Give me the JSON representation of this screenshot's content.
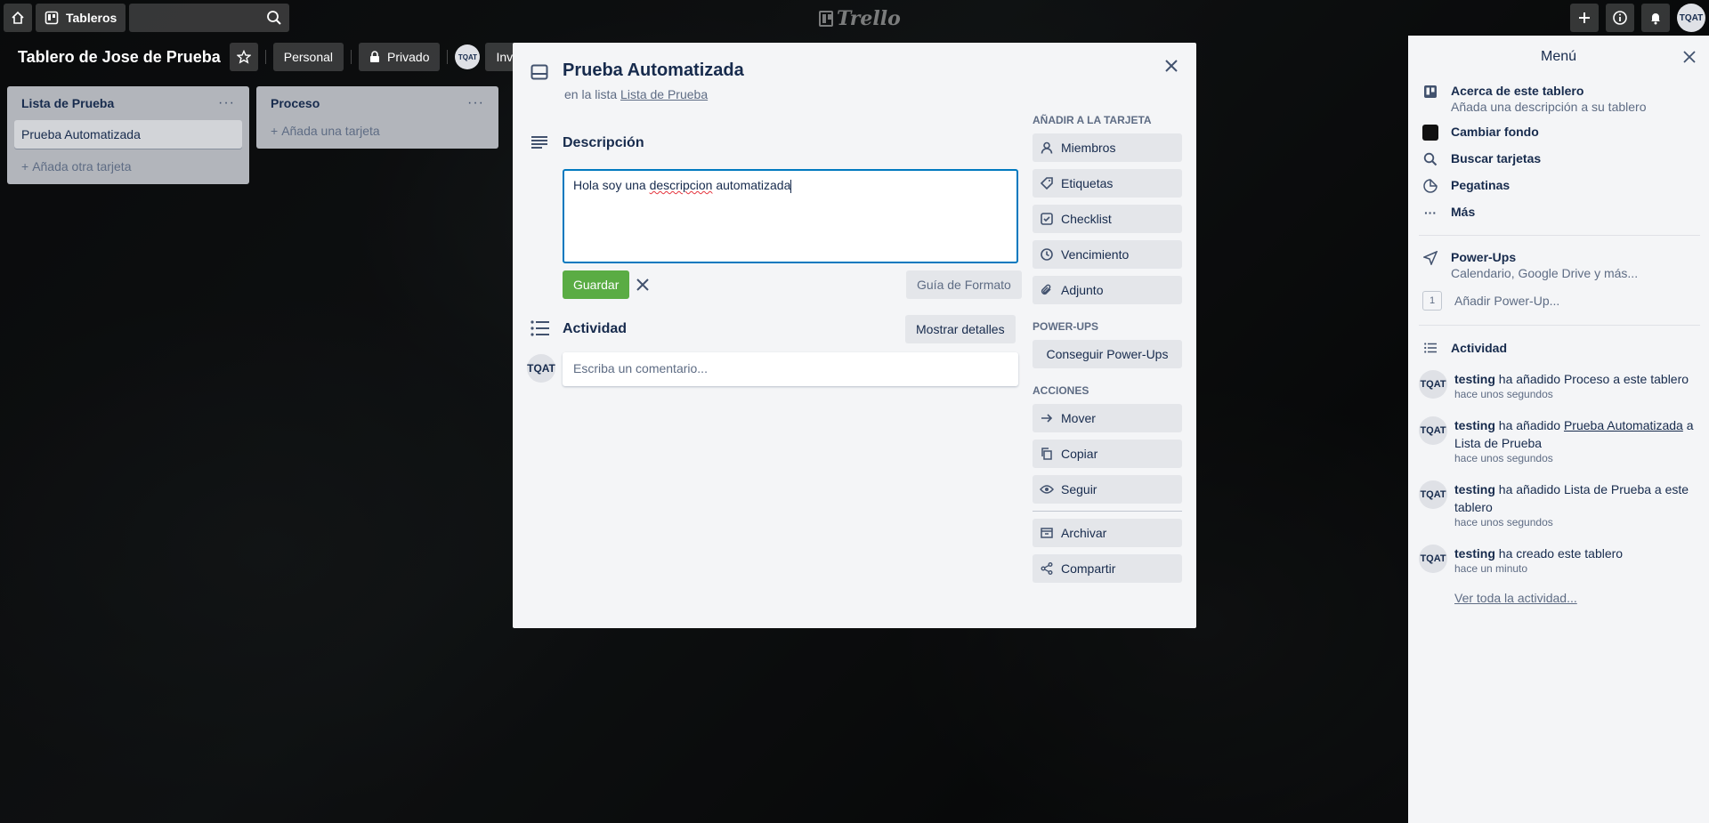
{
  "header": {
    "boards_label": "Tableros",
    "logo_text": "Trello",
    "avatar_initials": "TQAT"
  },
  "board": {
    "title": "Tablero de Jose de Prueba",
    "personal_label": "Personal",
    "privado_label": "Privado",
    "member_initials": "TQAT",
    "invite_label": "Inv"
  },
  "lists": [
    {
      "title": "Lista de Prueba",
      "cards": [
        "Prueba Automatizada"
      ],
      "add_label": "Añada otra tarjeta"
    },
    {
      "title": "Proceso",
      "cards": [],
      "add_label": "Añada una tarjeta"
    }
  ],
  "modal": {
    "title": "Prueba Automatizada",
    "in_list_prefix": "en la lista",
    "in_list_link": "Lista de Prueba",
    "description_heading": "Descripción",
    "description_value": {
      "before": "Hola soy una ",
      "misspelled": "descripcion",
      "after": " automatizada"
    },
    "save_label": "Guardar",
    "format_guide_label": "Guía de Formato",
    "activity_heading": "Actividad",
    "show_details_label": "Mostrar detalles",
    "comment_avatar": "TQAT",
    "comment_placeholder": "Escriba un comentario..."
  },
  "card_sidebar": {
    "add_heading": "Añadir a la tarjeta",
    "add_buttons": [
      "Miembros",
      "Etiquetas",
      "Checklist",
      "Vencimiento",
      "Adjunto"
    ],
    "powerups_heading": "Power-Ups",
    "powerups_button": "Conseguir Power-Ups",
    "actions_heading": "Acciones",
    "action_buttons": [
      "Mover",
      "Copiar",
      "Seguir"
    ],
    "archive_buttons": [
      "Archivar",
      "Compartir"
    ]
  },
  "menu": {
    "title": "Menú",
    "about_title": "Acerca de este tablero",
    "about_sub": "Añada una descripción a su tablero",
    "change_bg": "Cambiar fondo",
    "search_cards": "Buscar tarjetas",
    "stickers": "Pegatinas",
    "more": "Más",
    "powerups_title": "Power-Ups",
    "powerups_sub": "Calendario, Google Drive y más...",
    "powerups_count": "1",
    "add_powerup": "Añadir Power-Up...",
    "activity_title": "Actividad",
    "activities": [
      {
        "initials": "TQAT",
        "user": "testing",
        "text": " ha añadido Proceso a este tablero",
        "time": "hace unos segundos"
      },
      {
        "initials": "TQAT",
        "user": "testing",
        "pre": " ha añadido ",
        "link": "Prueba Automatizada",
        "post": " a Lista de Prueba",
        "time": "hace unos segundos"
      },
      {
        "initials": "TQAT",
        "user": "testing",
        "text": " ha añadido Lista de Prueba a este tablero",
        "time": "hace unos segundos"
      },
      {
        "initials": "TQAT",
        "user": "testing",
        "text": " ha creado este tablero",
        "time": "hace un minuto"
      }
    ],
    "see_all": "Ver toda la actividad..."
  },
  "colors": {
    "save_green": "#5aac44",
    "focus_blue": "#0079bf",
    "panel_bg": "#f4f5f7"
  }
}
